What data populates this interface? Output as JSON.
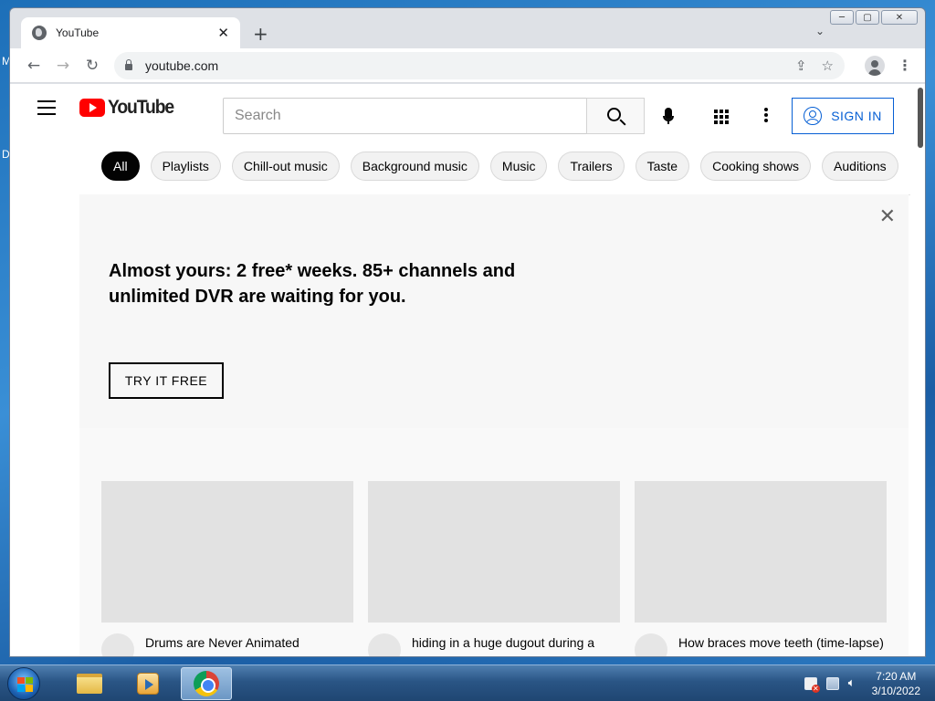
{
  "desktop": {
    "left_chars": [
      "M",
      "D"
    ]
  },
  "browser": {
    "tab": {
      "title": "YouTube"
    },
    "address": {
      "url": "youtube.com"
    },
    "window_controls": [
      "─",
      "▢",
      "✕"
    ]
  },
  "youtube": {
    "logo_text": "YouTube",
    "search": {
      "placeholder": "Search"
    },
    "sign_in_label": "SIGN IN",
    "chips": [
      "All",
      "Playlists",
      "Chill-out music",
      "Background music",
      "Music",
      "Trailers",
      "Taste",
      "Cooking shows",
      "Auditions"
    ],
    "banner": {
      "headline": "Almost yours: 2 free* weeks. 85+ channels and unlimited DVR are waiting for you.",
      "cta": "TRY IT FREE",
      "close": "✕"
    },
    "videos": [
      {
        "title": "Drums are Never Animated Correctly"
      },
      {
        "title": "hiding in a huge dugout during a snow storm, spending the nigh"
      },
      {
        "title": "How braces move teeth (time-lapse) - Braces Explained!"
      }
    ]
  },
  "taskbar": {
    "clock_time": "7:20 AM",
    "clock_date": "3/10/2022"
  },
  "colors": {
    "brand_red": "#ff0000",
    "link_blue": "#065fd4",
    "chip_active": "#030303"
  }
}
